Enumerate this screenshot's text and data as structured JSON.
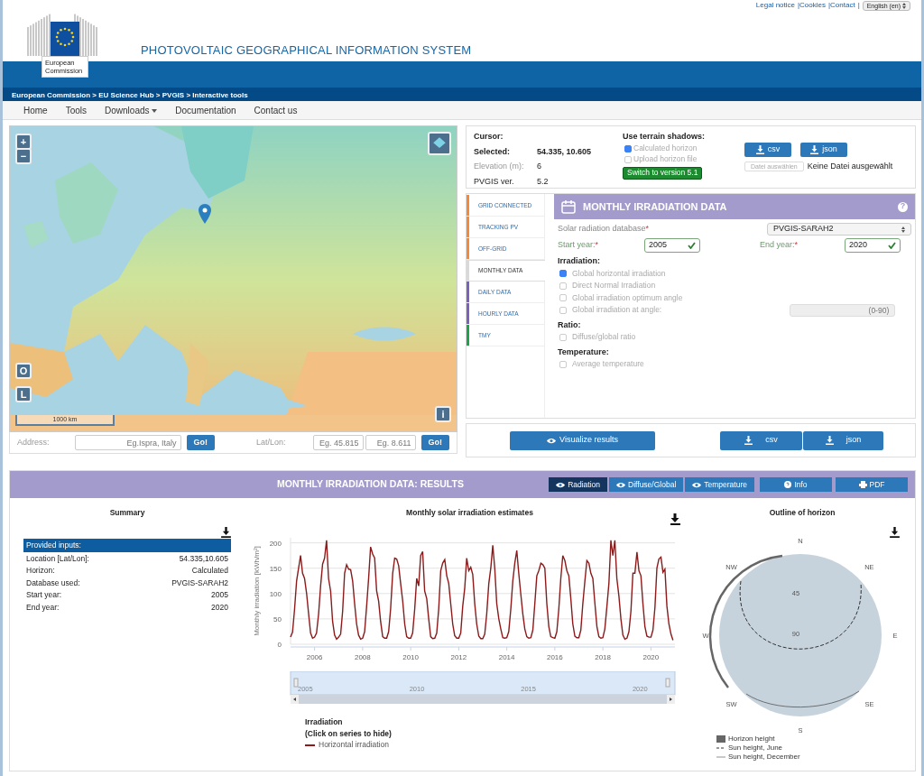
{
  "top_links": [
    "Legal notice",
    "|Cookies",
    "|Contact"
  ],
  "lang_separator": "|",
  "language": "English (en)",
  "logo": {
    "line1": "European",
    "line2": "Commission"
  },
  "site_title": "PHOTOVOLTAIC GEOGRAPHICAL INFORMATION SYSTEM",
  "breadcrumb": "European Commission > EU Science Hub > PVGIS > Interactive tools",
  "nav": [
    {
      "label": "Home",
      "dropdown": false
    },
    {
      "label": "Tools",
      "dropdown": false
    },
    {
      "label": "Downloads",
      "dropdown": true
    },
    {
      "label": "Documentation",
      "dropdown": false
    },
    {
      "label": "Contact us",
      "dropdown": false
    }
  ],
  "map": {
    "zoom_in": "+",
    "zoom_out": "−",
    "side_buttons": [
      "O",
      "L"
    ],
    "info": "i",
    "scale": "1000 km"
  },
  "address": {
    "label": "Address:",
    "placeholder": "Eg.Ispra, Italy",
    "button": "Go!"
  },
  "latlon": {
    "label": "Lat/Lon:",
    "lat_placeholder": "Eg. 45.815",
    "lon_placeholder": "Eg. 8.611",
    "button": "Go!"
  },
  "cursor": {
    "title": "Cursor:",
    "rows": [
      {
        "label": "Selected:",
        "value": "54.335, 10.605",
        "kind": "bold"
      },
      {
        "label": "Elevation (m):",
        "value": "6",
        "kind": "muted"
      },
      {
        "label": "PVGIS ver.",
        "value": "5.2",
        "kind": "plain"
      }
    ]
  },
  "terrain": {
    "title": "Use terrain shadows:",
    "options": [
      {
        "label": "Calculated horizon",
        "checked": true
      },
      {
        "label": "Upload horizon file",
        "checked": false
      }
    ],
    "switch_button": "Switch to version 5.1"
  },
  "horizon_export": {
    "buttons": [
      "csv",
      "json"
    ],
    "file_button": "Datei auswählen",
    "file_status": "Keine Datei ausgewählt"
  },
  "tool_tabs": [
    {
      "label": "GRID CONNECTED",
      "color": "#f5893a",
      "selected": false
    },
    {
      "label": "TRACKING PV",
      "color": "#f5893a",
      "selected": false
    },
    {
      "label": "OFF-GRID",
      "color": "#f5893a",
      "selected": false
    },
    {
      "label": "MONTHLY DATA",
      "color": "#d9d9d9",
      "selected": true
    },
    {
      "label": "DAILY DATA",
      "color": "#7b62b8",
      "selected": false
    },
    {
      "label": "HOURLY DATA",
      "color": "#7b62b8",
      "selected": false
    },
    {
      "label": "TMY",
      "color": "#1fa24a",
      "selected": false
    }
  ],
  "form": {
    "title": "MONTHLY IRRADIATION DATA",
    "help": "?",
    "db_label": "Solar radiation database",
    "db_mark": "*",
    "db_value": "PVGIS-SARAH2",
    "start_label": "Start year:",
    "start_mark": "*",
    "start_value": "2005",
    "end_label": "End year:",
    "end_mark": "*",
    "end_value": "2020",
    "sections": [
      {
        "heading": "Irradiation:",
        "options": [
          {
            "label": "Global horizontal irradiation",
            "checked": true
          },
          {
            "label": "Direct Normal Irradiation",
            "checked": false
          },
          {
            "label": "Global irradiation optimum angle",
            "checked": false
          },
          {
            "label": "Global irradiation at angle:",
            "checked": false,
            "placeholder": "(0-90)"
          }
        ]
      },
      {
        "heading": "Ratio:",
        "options": [
          {
            "label": "Diffuse/global ratio",
            "checked": false
          }
        ]
      },
      {
        "heading": "Temperature:",
        "options": [
          {
            "label": "Average temperature",
            "checked": false
          }
        ]
      }
    ]
  },
  "actions": {
    "visualize": "Visualize results",
    "csv": "csv",
    "json": "json"
  },
  "results": {
    "title": "MONTHLY IRRADIATION DATA: RESULTS",
    "view_tabs": [
      {
        "label": "Radiation",
        "selected": true
      },
      {
        "label": "Diffuse/Global",
        "selected": false
      },
      {
        "label": "Temperature",
        "selected": false
      }
    ],
    "buttons": [
      {
        "label": "Info",
        "kind": "info"
      },
      {
        "label": "PDF",
        "kind": "print"
      }
    ]
  },
  "summary": {
    "title": "Summary",
    "header": "Provided inputs:",
    "rows": [
      {
        "label": "Location [Lat/Lon]:",
        "value": "54.335,10.605"
      },
      {
        "label": "Horizon:",
        "value": "Calculated"
      },
      {
        "label": "Database used:",
        "value": "PVGIS-SARAH2"
      },
      {
        "label": "Start year:",
        "value": "2005"
      },
      {
        "label": "End year:",
        "value": "2020"
      }
    ]
  },
  "chart": {
    "title": "Monthly solar irradiation estimates",
    "navigator_labels": [
      "2005",
      "2010",
      "2015",
      "2020"
    ],
    "legend_title": "Irradiation",
    "legend_hint": "(Click on series to hide)",
    "chart_data": {
      "type": "line",
      "ylabel": "Monthly irradiation [kWh/m²]",
      "ylim": [
        0,
        210
      ],
      "grid": true,
      "yticks": [
        0,
        50,
        100,
        150,
        200
      ],
      "xlim": [
        2005,
        2021
      ],
      "xticks": [
        {
          "value": 2006,
          "label": "2006"
        },
        {
          "value": 2008,
          "label": "2008"
        },
        {
          "value": 2010,
          "label": "2010"
        },
        {
          "value": 2012,
          "label": "2012"
        },
        {
          "value": 2014,
          "label": "2014"
        },
        {
          "value": 2016,
          "label": "2016"
        },
        {
          "value": 2018,
          "label": "2018"
        },
        {
          "value": 2020,
          "label": "2020"
        }
      ],
      "x": [
        2005,
        2005.083,
        2005.167,
        2005.25,
        2005.333,
        2005.417,
        2005.5,
        2005.583,
        2005.667,
        2005.75,
        2005.833,
        2005.917,
        2006,
        2006.083,
        2006.167,
        2006.25,
        2006.333,
        2006.417,
        2006.5,
        2006.583,
        2006.667,
        2006.75,
        2006.833,
        2006.917,
        2007,
        2007.083,
        2007.167,
        2007.25,
        2007.333,
        2007.417,
        2007.5,
        2007.583,
        2007.667,
        2007.75,
        2007.833,
        2007.917,
        2008,
        2008.083,
        2008.167,
        2008.25,
        2008.333,
        2008.417,
        2008.5,
        2008.583,
        2008.667,
        2008.75,
        2008.833,
        2008.917,
        2009,
        2009.083,
        2009.167,
        2009.25,
        2009.333,
        2009.417,
        2009.5,
        2009.583,
        2009.667,
        2009.75,
        2009.833,
        2009.917,
        2010,
        2010.083,
        2010.167,
        2010.25,
        2010.333,
        2010.417,
        2010.5,
        2010.583,
        2010.667,
        2010.75,
        2010.833,
        2010.917,
        2011,
        2011.083,
        2011.167,
        2011.25,
        2011.333,
        2011.417,
        2011.5,
        2011.583,
        2011.667,
        2011.75,
        2011.833,
        2011.917,
        2012,
        2012.083,
        2012.167,
        2012.25,
        2012.333,
        2012.417,
        2012.5,
        2012.583,
        2012.667,
        2012.75,
        2012.833,
        2012.917,
        2013,
        2013.083,
        2013.167,
        2013.25,
        2013.333,
        2013.417,
        2013.5,
        2013.583,
        2013.667,
        2013.75,
        2013.833,
        2013.917,
        2014,
        2014.083,
        2014.167,
        2014.25,
        2014.333,
        2014.417,
        2014.5,
        2014.583,
        2014.667,
        2014.75,
        2014.833,
        2014.917,
        2015,
        2015.083,
        2015.167,
        2015.25,
        2015.333,
        2015.417,
        2015.5,
        2015.583,
        2015.667,
        2015.75,
        2015.833,
        2015.917,
        2016,
        2016.083,
        2016.167,
        2016.25,
        2016.333,
        2016.417,
        2016.5,
        2016.583,
        2016.667,
        2016.75,
        2016.833,
        2016.917,
        2017,
        2017.083,
        2017.167,
        2017.25,
        2017.333,
        2017.417,
        2017.5,
        2017.583,
        2017.667,
        2017.75,
        2017.833,
        2017.917,
        2018,
        2018.083,
        2018.167,
        2018.25,
        2018.333,
        2018.417,
        2018.5,
        2018.583,
        2018.667,
        2018.75,
        2018.833,
        2018.917,
        2019,
        2019.083,
        2019.167,
        2019.25,
        2019.333,
        2019.417,
        2019.5,
        2019.583,
        2019.667,
        2019.75,
        2019.833,
        2019.917,
        2020,
        2020.083,
        2020.167,
        2020.25,
        2020.333,
        2020.417,
        2020.5,
        2020.583,
        2020.667,
        2020.75,
        2020.833,
        2020.917
      ],
      "series": [
        {
          "name": "Horizontal irradiation",
          "color": "#8b1a1a",
          "values": [
            14,
            24,
            68,
            125,
            150,
            175,
            140,
            130,
            100,
            60,
            22,
            12,
            14,
            22,
            60,
            115,
            158,
            170,
            205,
            130,
            105,
            45,
            18,
            10,
            14,
            20,
            65,
            140,
            157,
            148,
            147,
            125,
            80,
            40,
            18,
            10,
            12,
            25,
            75,
            130,
            192,
            178,
            170,
            105,
            85,
            45,
            15,
            12,
            12,
            25,
            70,
            140,
            170,
            168,
            155,
            120,
            85,
            40,
            15,
            12,
            12,
            22,
            70,
            130,
            115,
            175,
            183,
            105,
            90,
            50,
            15,
            11,
            12,
            22,
            70,
            145,
            160,
            167,
            135,
            120,
            80,
            40,
            17,
            12,
            12,
            22,
            75,
            110,
            170,
            145,
            152,
            138,
            80,
            40,
            16,
            11,
            11,
            20,
            60,
            120,
            150,
            195,
            150,
            80,
            50,
            30,
            13,
            12,
            13,
            25,
            70,
            125,
            160,
            185,
            140,
            100,
            60,
            30,
            15,
            12,
            13,
            28,
            80,
            135,
            145,
            160,
            157,
            150,
            80,
            35,
            15,
            13,
            12,
            25,
            70,
            130,
            175,
            165,
            145,
            135,
            90,
            40,
            16,
            13,
            13,
            28,
            80,
            125,
            165,
            160,
            140,
            130,
            80,
            35,
            15,
            12,
            13,
            30,
            75,
            120,
            205,
            175,
            205,
            130,
            95,
            50,
            18,
            10,
            12,
            25,
            65,
            140,
            140,
            182,
            145,
            135,
            80,
            35,
            16,
            14,
            14,
            28,
            72,
            150,
            168,
            172,
            142,
            148,
            75,
            40,
            20,
            8
          ]
        }
      ]
    }
  },
  "horizon": {
    "title": "Outline of horizon",
    "directions": [
      "N",
      "NE",
      "E",
      "SE",
      "S",
      "SW",
      "W",
      "NW"
    ],
    "rings": [
      "45",
      "90"
    ],
    "legend": [
      {
        "kind": "area",
        "label": "Horizon height"
      },
      {
        "kind": "dashed",
        "label": "Sun height, June"
      },
      {
        "kind": "thin",
        "label": "Sun height, December"
      }
    ]
  }
}
